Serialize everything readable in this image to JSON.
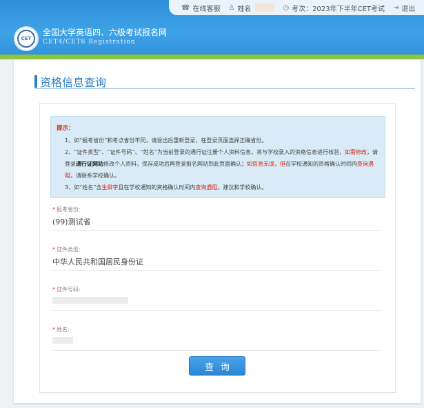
{
  "header": {
    "topbar": {
      "service_label": "在线客服",
      "name_label": "姓名",
      "exam_label": "考次：2023年下半年CET考试",
      "logout_label": "退出"
    },
    "logo_text": "CET",
    "site_title": "全国大学英语四、六级考试报名网",
    "site_subtitle": "CET4/CET6  Registration"
  },
  "page": {
    "title": "资格信息查询"
  },
  "notice": {
    "tip": "提示：",
    "line1": "1、如“报考省份”和考点省份不同，请退出后重新登录，在登录页面选择正确省份。",
    "line2_a": "2、“证件类型”、“证件号码”、“姓名”为当前登录的通行证注册个人资料信息，将与学校录入的资格信息进行核验，",
    "line2_b": "如需修改",
    "line2_c": "，请登录",
    "line2_d": "通行证网站",
    "line2_e": "修改个人资料，保存成功后再登录报名网站到此页面确认；",
    "line2_f": "如信息无误，但",
    "line2_g": "在学校通知的资格确认时间内",
    "line2_h": "查询遇阻",
    "line2_i": "，请联系学校确认。",
    "line3_a": "3、如“姓名”含",
    "line3_b": "生僻字",
    "line3_c": "且在学校通知的资格确认时间内",
    "line3_d": "查询遇阻",
    "line3_e": "，建议和学校确认。"
  },
  "fields": {
    "province_label": "报考省份:",
    "province_value": "(99)测试省",
    "idtype_label": "证件类型:",
    "idtype_value": "中华人民共和国居民身份证",
    "idnum_label": "证件号码:",
    "name_label": "姓名:"
  },
  "query_button": "查询",
  "colors": {
    "header_blue": "#2f8fd8",
    "accent_green": "#8cc63e",
    "title_blue": "#2f7fc4",
    "warning_red": "#d9261c"
  }
}
